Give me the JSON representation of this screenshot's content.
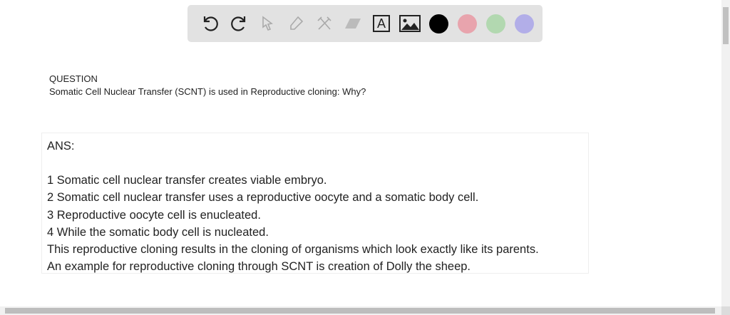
{
  "toolbar": {
    "tools": [
      "undo-icon",
      "redo-icon",
      "pointer-icon",
      "pen-icon",
      "tools-icon",
      "eraser-icon",
      "text-icon",
      "image-icon"
    ],
    "colors": [
      "#000000",
      "#e8a4ad",
      "#b2d8b0",
      "#b2aee8"
    ],
    "text_tool_label": "A"
  },
  "question": {
    "label": "QUESTION",
    "text": "Somatic Cell Nuclear Transfer (SCNT) is used in Reproductive cloning: Why?"
  },
  "answer": {
    "heading": "ANS:",
    "lines": [
      "1 Somatic cell nuclear transfer creates viable embryo.",
      "2 Somatic cell nuclear transfer uses a reproductive oocyte and a somatic body cell.",
      "3 Reproductive oocyte cell is enucleated.",
      "4 While the somatic body cell is nucleated.",
      "This reproductive cloning results in the cloning of organisms which look exactly like its parents.",
      "An example for reproductive cloning through SCNT is creation of Dolly the sheep."
    ]
  }
}
